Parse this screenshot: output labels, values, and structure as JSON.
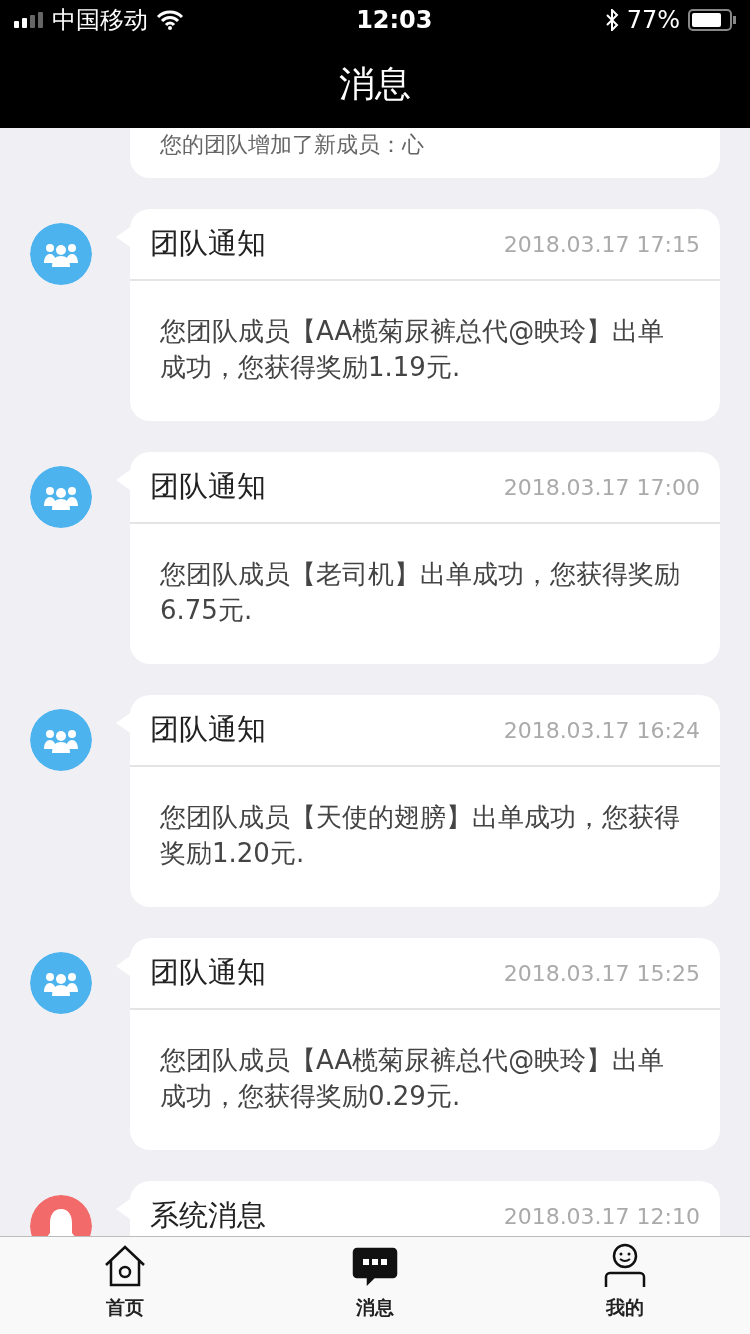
{
  "status_bar": {
    "carrier": "中国移动",
    "time": "12:03",
    "battery": "77%"
  },
  "header": {
    "title": "消息"
  },
  "partial_message": {
    "body": "您的团队增加了新成员：心"
  },
  "messages": [
    {
      "kind": "team",
      "title": "团队通知",
      "time": "2018.03.17 17:15",
      "body": "您团队成员【AA榄菊尿裤总代@映玲】出单成功，您获得奖励1.19元."
    },
    {
      "kind": "team",
      "title": "团队通知",
      "time": "2018.03.17 17:00",
      "body": "您团队成员【老司机】出单成功，您获得奖励6.75元."
    },
    {
      "kind": "team",
      "title": "团队通知",
      "time": "2018.03.17 16:24",
      "body": "您团队成员【天使的翅膀】出单成功，您获得奖励1.20元."
    },
    {
      "kind": "team",
      "title": "团队通知",
      "time": "2018.03.17 15:25",
      "body": "您团队成员【AA榄菊尿裤总代@映玲】出单成功，您获得奖励0.29元."
    },
    {
      "kind": "system",
      "title": "系统消息",
      "time": "2018.03.17 12:10"
    }
  ],
  "tab_bar": [
    {
      "kind": "home",
      "label": "首页",
      "selected": false
    },
    {
      "kind": "messages",
      "label": "消息",
      "selected": true
    },
    {
      "kind": "me",
      "label": "我的",
      "selected": false
    }
  ]
}
